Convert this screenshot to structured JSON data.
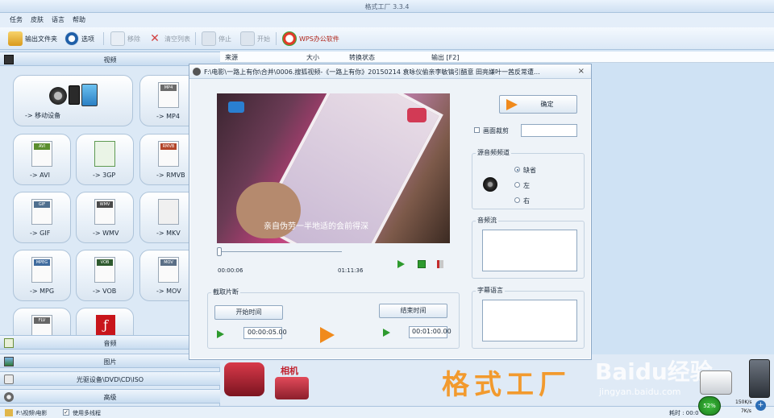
{
  "window": {
    "title": "格式工厂 3.3.4"
  },
  "menu": [
    "任务",
    "皮肤",
    "语言",
    "帮助"
  ],
  "toolbar": {
    "output_folder": "输出文件夹",
    "options": "选项",
    "remove": "移除",
    "clear_list": "清空列表",
    "stop": "停止",
    "start": "开始",
    "wps": "WPS办公软件"
  },
  "left": {
    "video_header": "视频",
    "tiles": {
      "mobile": "-> 移动设备",
      "mp4": "-> MP4",
      "avi": "-> AVI",
      "3gp": "-> 3GP",
      "rmvb": "-> RMVB",
      "gif": "-> GIF",
      "wmv": "-> WMV",
      "mkv": "-> MKV",
      "mpg": "-> MPG",
      "vob": "-> VOB",
      "mov": "-> MOV"
    },
    "icon_tags": {
      "mp4": "MP4",
      "avi": "AVI",
      "rmvb": "RMVB",
      "gif": "GIF",
      "wmv": "WMV",
      "mpeg": "MPEG",
      "vob": "VOB",
      "mov": "MOV",
      "flv": "FLV"
    },
    "audio_header": "音频",
    "image_header": "图片",
    "disc_header": "光驱设备\\DVD\\CD\\ISO",
    "advanced_header": "高级"
  },
  "list": {
    "columns": [
      "来源",
      "大小",
      "转换状态",
      "输出 [F2]"
    ]
  },
  "dialog": {
    "title": "F:\\电影\\一路上有你\\合并\\0006.搜狐视频-《一路上有你》20150214 袁咏仪偷亲李敏镐引醋意 田亮嫌叶一茜反常遭...",
    "close": "×",
    "ok": "确定",
    "crop": "画面裁剪",
    "audio_channel": "源音频频道",
    "radio_default": "缺省",
    "radio_left": "左",
    "radio_right": "右",
    "audio_stream": "音频流",
    "subtitle": "字幕语言",
    "clip": "截取片断",
    "start_time_btn": "开始时间",
    "end_time_btn": "结束时间",
    "start_time": "00:00:05.00",
    "end_time": "00:01:00.00",
    "pos_time": "00:00:06",
    "duration": "01:11:36",
    "video_subtitle": "亲自伪劳一半地适的会前得深"
  },
  "banner": {
    "camera_text": "相机",
    "app_logo": "格式工厂",
    "watermark": "Baidu经验",
    "watermark_url": "jingyan.baidu.com"
  },
  "status": {
    "path": "F:\\视频\\电影",
    "multithread": "使用多线程",
    "elapsed": "耗时 : 00:0",
    "cpu": "52%",
    "up": "150K/s",
    "down": "7K/s",
    "colors": {
      "accent": "#2c6db5",
      "orange": "#f08a1c",
      "logo": "#f29a2e"
    }
  }
}
